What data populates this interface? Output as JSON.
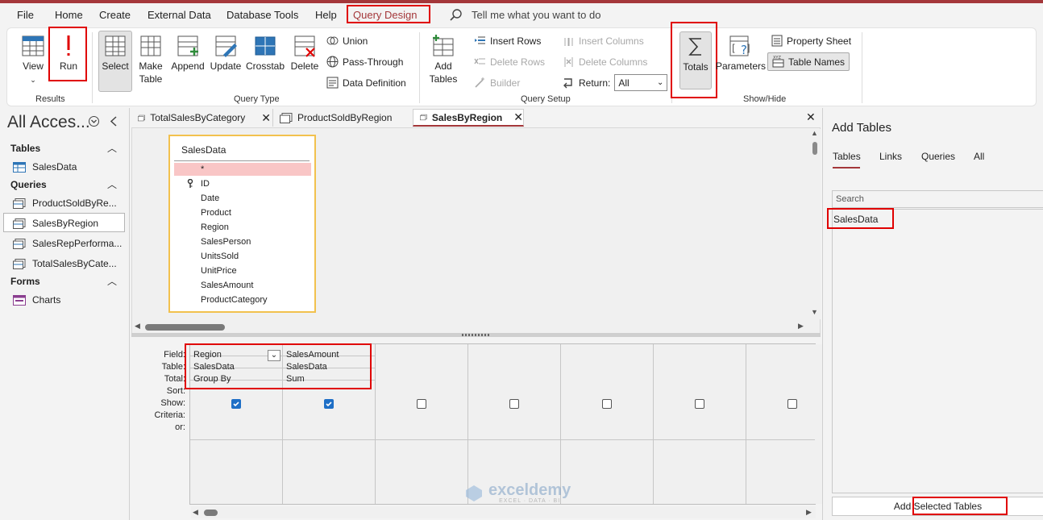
{
  "menu": {
    "items": [
      "File",
      "Home",
      "Create",
      "External Data",
      "Database Tools",
      "Help",
      "Query Design"
    ],
    "tell_me": "Tell me what you want to do"
  },
  "ribbon": {
    "results": {
      "label": "Results",
      "view": "View",
      "run": "Run"
    },
    "query_type": {
      "label": "Query Type",
      "select": "Select",
      "make_table_1": "Make",
      "make_table_2": "Table",
      "append": "Append",
      "update": "Update",
      "crosstab": "Crosstab",
      "delete": "Delete",
      "union": "Union",
      "pass_through": "Pass-Through",
      "data_definition": "Data Definition"
    },
    "query_setup": {
      "label": "Query Setup",
      "add_tables_1": "Add",
      "add_tables_2": "Tables",
      "insert_rows": "Insert Rows",
      "delete_rows": "Delete Rows",
      "builder": "Builder",
      "insert_columns": "Insert Columns",
      "delete_columns": "Delete Columns",
      "return_label": "Return:",
      "return_value": "All"
    },
    "show_hide": {
      "label": "Show/Hide",
      "totals": "Totals",
      "parameters": "Parameters",
      "property_sheet": "Property Sheet",
      "table_names": "Table Names"
    }
  },
  "nav": {
    "title": "All Acces...",
    "sections": [
      {
        "label": "Tables",
        "items": [
          "SalesData"
        ]
      },
      {
        "label": "Queries",
        "items": [
          "ProductSoldByRe...",
          "SalesByRegion",
          "SalesRepPerforma...",
          "TotalSalesByCate..."
        ]
      },
      {
        "label": "Forms",
        "items": [
          "Charts"
        ]
      }
    ]
  },
  "doc_tabs": [
    "TotalSalesByCategory",
    "ProductSoldByRegion",
    "SalesByRegion"
  ],
  "table_box": {
    "title": "SalesData",
    "fields": [
      "*",
      "ID",
      "Date",
      "Product",
      "Region",
      "SalesPerson",
      "UnitsSold",
      "UnitPrice",
      "SalesAmount",
      "ProductCategory"
    ]
  },
  "grid": {
    "row_labels": [
      "Field:",
      "Table:",
      "Total:",
      "Sort:",
      "Show:",
      "Criteria:",
      "or:"
    ],
    "columns": [
      {
        "field": "Region",
        "table": "SalesData",
        "total": "Group By",
        "show": true
      },
      {
        "field": "SalesAmount",
        "table": "SalesData",
        "total": "Sum",
        "show": true
      },
      {
        "field": "",
        "table": "",
        "total": "",
        "show": false
      },
      {
        "field": "",
        "table": "",
        "total": "",
        "show": false
      },
      {
        "field": "",
        "table": "",
        "total": "",
        "show": false
      },
      {
        "field": "",
        "table": "",
        "total": "",
        "show": false
      },
      {
        "field": "",
        "table": "",
        "total": "",
        "show": false
      }
    ]
  },
  "add_tables": {
    "title": "Add Tables",
    "tabs": [
      "Tables",
      "Links",
      "Queries",
      "All"
    ],
    "search_placeholder": "Search",
    "list": [
      "SalesData"
    ],
    "button": "Add Selected Tables"
  },
  "watermark": {
    "name": "exceldemy",
    "tagline": "EXCEL · DATA · BI"
  },
  "colors": {
    "accent_red": "#a4373a",
    "highlight_red": "#e00000",
    "checkbox_blue": "#1e6fc6",
    "table_border": "#f2c14e",
    "selected_field": "#f9c6c6"
  }
}
